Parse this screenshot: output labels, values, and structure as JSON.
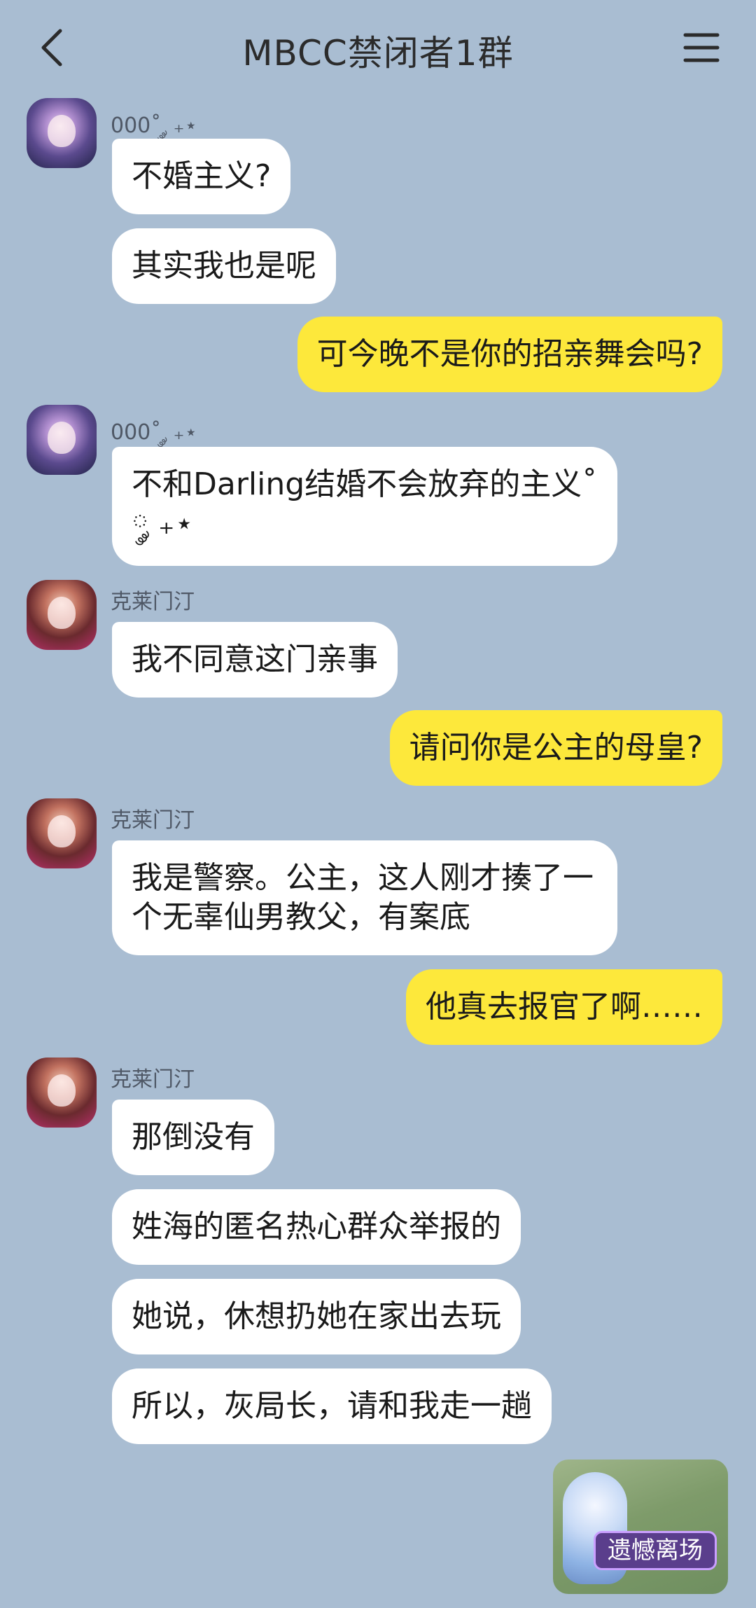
{
  "header": {
    "title": "MBCC禁闭者1群",
    "back_icon": "chevron-left-icon",
    "menu_icon": "hamburger-menu-icon"
  },
  "messages": [
    {
      "sender": "000˚ ༘ ₊⋆",
      "text": "不婚主义?"
    },
    {
      "text": "其实我也是呢"
    },
    {
      "text": "可今晚不是你的招亲舞会吗?"
    },
    {
      "sender": "000˚ ༘ ₊⋆",
      "text": "不和Darling结婚不会放弃的主义˚ ༘ ₊⋆"
    },
    {
      "sender": "克莱门汀",
      "text": "我不同意这门亲事"
    },
    {
      "text": "请问你是公主的母皇?"
    },
    {
      "sender": "克莱门汀",
      "text": "我是警察。公主，这人刚才揍了一个无辜仙男教父，有案底"
    },
    {
      "text": "他真去报官了啊……"
    },
    {
      "sender": "克莱门汀",
      "text": "那倒没有"
    },
    {
      "text": "姓海的匿名热心群众举报的"
    },
    {
      "text": "她说，休想扔她在家出去玩"
    },
    {
      "text": "所以，灰局长，请和我走一趟"
    }
  ],
  "sticker": {
    "caption": "遗憾离场"
  },
  "colors": {
    "background": "#a9bdd2",
    "incoming_bubble": "#ffffff",
    "outgoing_bubble": "#fde83b"
  }
}
